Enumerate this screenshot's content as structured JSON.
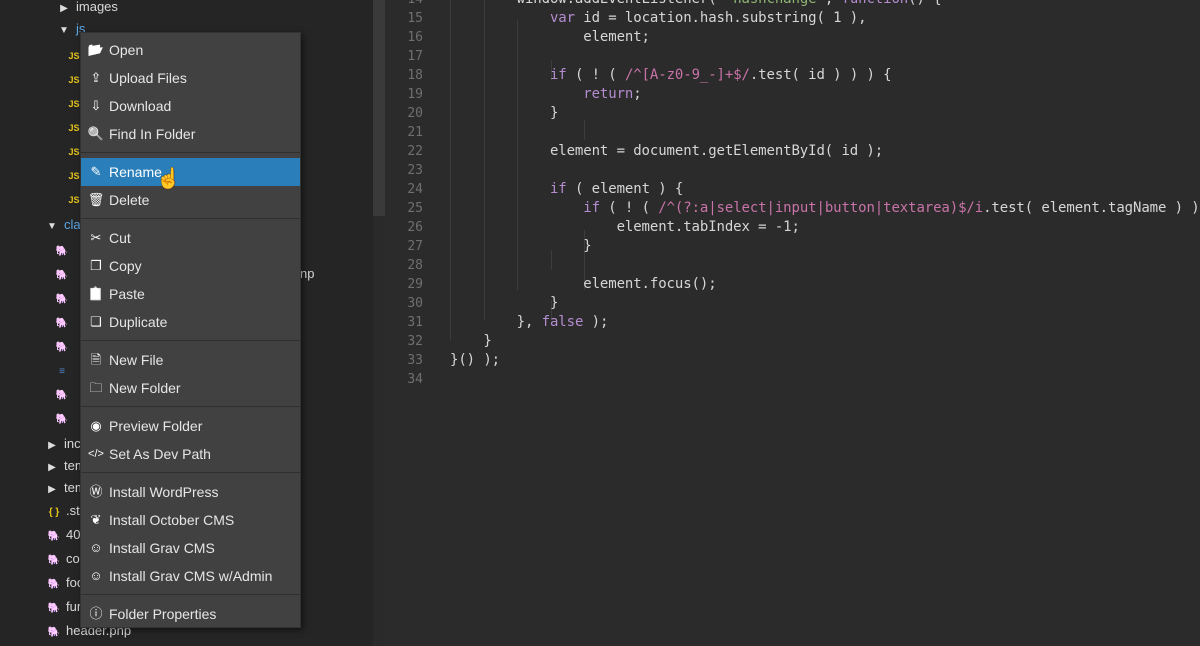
{
  "sidebar": {
    "items": [
      {
        "label": "images",
        "icon": "caret-right",
        "top": 0
      },
      {
        "label": "js",
        "icon": "caret-down"
      },
      {
        "label": "",
        "icon": "js"
      },
      {
        "label": "",
        "icon": "js"
      },
      {
        "label": "",
        "icon": "js"
      },
      {
        "label": "",
        "icon": "js"
      },
      {
        "label": "",
        "icon": "js"
      },
      {
        "label": "",
        "icon": "js"
      },
      {
        "label": "",
        "icon": "js"
      },
      {
        "label": "clas",
        "icon": "caret-down"
      },
      {
        "label": "",
        "icon": "php"
      },
      {
        "label": "np",
        "icon": "php"
      },
      {
        "label": "",
        "icon": "php"
      },
      {
        "label": "",
        "icon": "php"
      },
      {
        "label": "",
        "icon": "php"
      },
      {
        "label": "",
        "icon": "txt"
      },
      {
        "label": "",
        "icon": "php"
      },
      {
        "label": "",
        "icon": "php"
      },
      {
        "label": "inc",
        "icon": "caret-right"
      },
      {
        "label": "tem",
        "icon": "caret-right"
      },
      {
        "label": "tem",
        "icon": "caret-right"
      },
      {
        "label": ".st",
        "icon": "json"
      },
      {
        "label": "40",
        "icon": "php"
      },
      {
        "label": "co",
        "icon": "php"
      },
      {
        "label": "foo",
        "icon": "php"
      },
      {
        "label": "fur",
        "icon": "php"
      },
      {
        "label": "header.php",
        "icon": "php"
      }
    ]
  },
  "context_menu": {
    "groups": [
      [
        {
          "label": "Open",
          "icon": "folder-open-icon"
        },
        {
          "label": "Upload Files",
          "icon": "file-upload-icon"
        },
        {
          "label": "Download",
          "icon": "file-download-icon"
        },
        {
          "label": "Find In Folder",
          "icon": "search-icon"
        }
      ],
      [
        {
          "label": "Rename",
          "icon": "edit-icon",
          "active": true
        },
        {
          "label": "Delete",
          "icon": "trash-icon"
        }
      ],
      [
        {
          "label": "Cut",
          "icon": "scissors-icon"
        },
        {
          "label": "Copy",
          "icon": "copy-icon"
        },
        {
          "label": "Paste",
          "icon": "paste-icon"
        },
        {
          "label": "Duplicate",
          "icon": "duplicate-icon"
        }
      ],
      [
        {
          "label": "New File",
          "icon": "new-file-icon"
        },
        {
          "label": "New Folder",
          "icon": "new-folder-icon"
        }
      ],
      [
        {
          "label": "Preview Folder",
          "icon": "eye-icon"
        },
        {
          "label": "Set As Dev Path",
          "icon": "code-icon"
        }
      ],
      [
        {
          "label": "Install WordPress",
          "icon": "wordpress-icon"
        },
        {
          "label": "Install October CMS",
          "icon": "leaf-icon"
        },
        {
          "label": "Install Grav CMS",
          "icon": "grav-icon"
        },
        {
          "label": "Install Grav CMS w/Admin",
          "icon": "grav-icon"
        }
      ],
      [
        {
          "label": "Folder Properties",
          "icon": "info-icon"
        }
      ]
    ]
  },
  "editor": {
    "lines": [
      {
        "n": "14",
        "tokens": [
          [
            "        window.addEventListener( ",
            ""
          ],
          [
            "\"hashchange\"",
            "st"
          ],
          [
            ", ",
            ""
          ],
          [
            "function",
            "kw"
          ],
          [
            "() {",
            ""
          ]
        ]
      },
      {
        "n": "15",
        "tokens": [
          [
            "            ",
            ""
          ],
          [
            "var",
            "kw"
          ],
          [
            " id = location.hash.substring( 1 ),",
            ""
          ]
        ]
      },
      {
        "n": "16",
        "tokens": [
          [
            "                element;",
            ""
          ]
        ]
      },
      {
        "n": "17",
        "tokens": []
      },
      {
        "n": "18",
        "tokens": [
          [
            "            ",
            ""
          ],
          [
            "if",
            "kw"
          ],
          [
            " ( ! ( ",
            ""
          ],
          [
            "/^[A-z0-9_-]+$/",
            "re"
          ],
          [
            ".test( id ) ) ) {",
            ""
          ]
        ]
      },
      {
        "n": "19",
        "tokens": [
          [
            "                ",
            ""
          ],
          [
            "return",
            "kw"
          ],
          [
            ";",
            ""
          ]
        ]
      },
      {
        "n": "20",
        "tokens": [
          [
            "            }",
            ""
          ]
        ]
      },
      {
        "n": "21",
        "tokens": []
      },
      {
        "n": "22",
        "tokens": [
          [
            "            element = document.getElementById( id );",
            ""
          ]
        ]
      },
      {
        "n": "23",
        "tokens": []
      },
      {
        "n": "24",
        "tokens": [
          [
            "            ",
            ""
          ],
          [
            "if",
            "kw"
          ],
          [
            " ( element ) {",
            ""
          ]
        ]
      },
      {
        "n": "25",
        "tokens": [
          [
            "                ",
            ""
          ],
          [
            "if",
            "kw"
          ],
          [
            " ( ! ( ",
            ""
          ],
          [
            "/^(?:a|select|input|button|textarea)$/i",
            "re"
          ],
          [
            ".test( element.tagName ) ) ) {",
            ""
          ]
        ]
      },
      {
        "n": "26",
        "tokens": [
          [
            "                    element.tabIndex = -1;",
            ""
          ]
        ]
      },
      {
        "n": "27",
        "tokens": [
          [
            "                }",
            ""
          ]
        ]
      },
      {
        "n": "28",
        "tokens": []
      },
      {
        "n": "29",
        "tokens": [
          [
            "                element.focus();",
            ""
          ]
        ]
      },
      {
        "n": "30",
        "tokens": [
          [
            "            }",
            ""
          ]
        ]
      },
      {
        "n": "31",
        "tokens": [
          [
            "        }, ",
            ""
          ],
          [
            "false",
            "kw"
          ],
          [
            " );",
            ""
          ]
        ]
      },
      {
        "n": "32",
        "tokens": [
          [
            "    }",
            ""
          ]
        ]
      },
      {
        "n": "33",
        "tokens": [
          [
            "}() );",
            ""
          ]
        ]
      },
      {
        "n": "34",
        "tokens": []
      }
    ]
  }
}
